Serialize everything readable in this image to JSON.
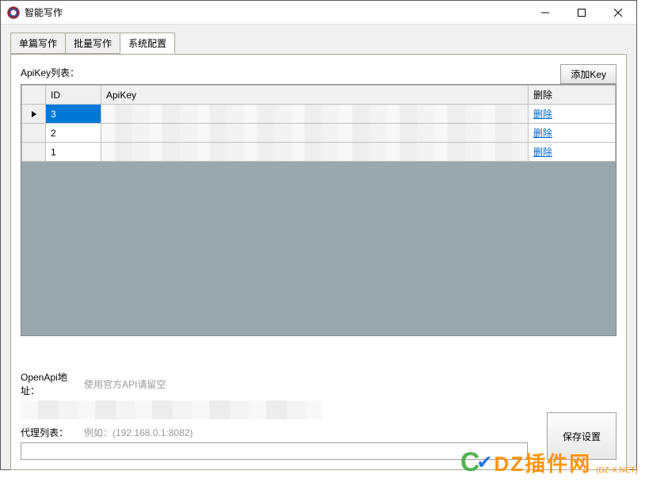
{
  "window": {
    "title": "智能写作"
  },
  "tabs": [
    {
      "label": "单篇写作",
      "active": false
    },
    {
      "label": "批量写作",
      "active": false
    },
    {
      "label": "系统配置",
      "active": true
    }
  ],
  "apikey_section": {
    "label": "ApiKey列表：",
    "add_button": "添加Key",
    "columns": {
      "rowheader": "",
      "id": "ID",
      "apikey": "ApiKey",
      "delete": "删除"
    },
    "rows": [
      {
        "id": "3",
        "apikey": "",
        "delete_text": "删除",
        "selected": true
      },
      {
        "id": "2",
        "apikey": "",
        "delete_text": "删除",
        "selected": false
      },
      {
        "id": "1",
        "apikey": "",
        "delete_text": "删除",
        "selected": false
      }
    ]
  },
  "openapi": {
    "label": "OpenApi地址：",
    "placeholder": "使用官方API请留空",
    "value": ""
  },
  "proxy": {
    "label": "代理列表：",
    "placeholder": "例如：(192.168.0.1:8082)",
    "value": ""
  },
  "save_button": "保存设置",
  "watermark": {
    "text": "DZ插件网",
    "sub": "(DZ-X.NET)"
  }
}
